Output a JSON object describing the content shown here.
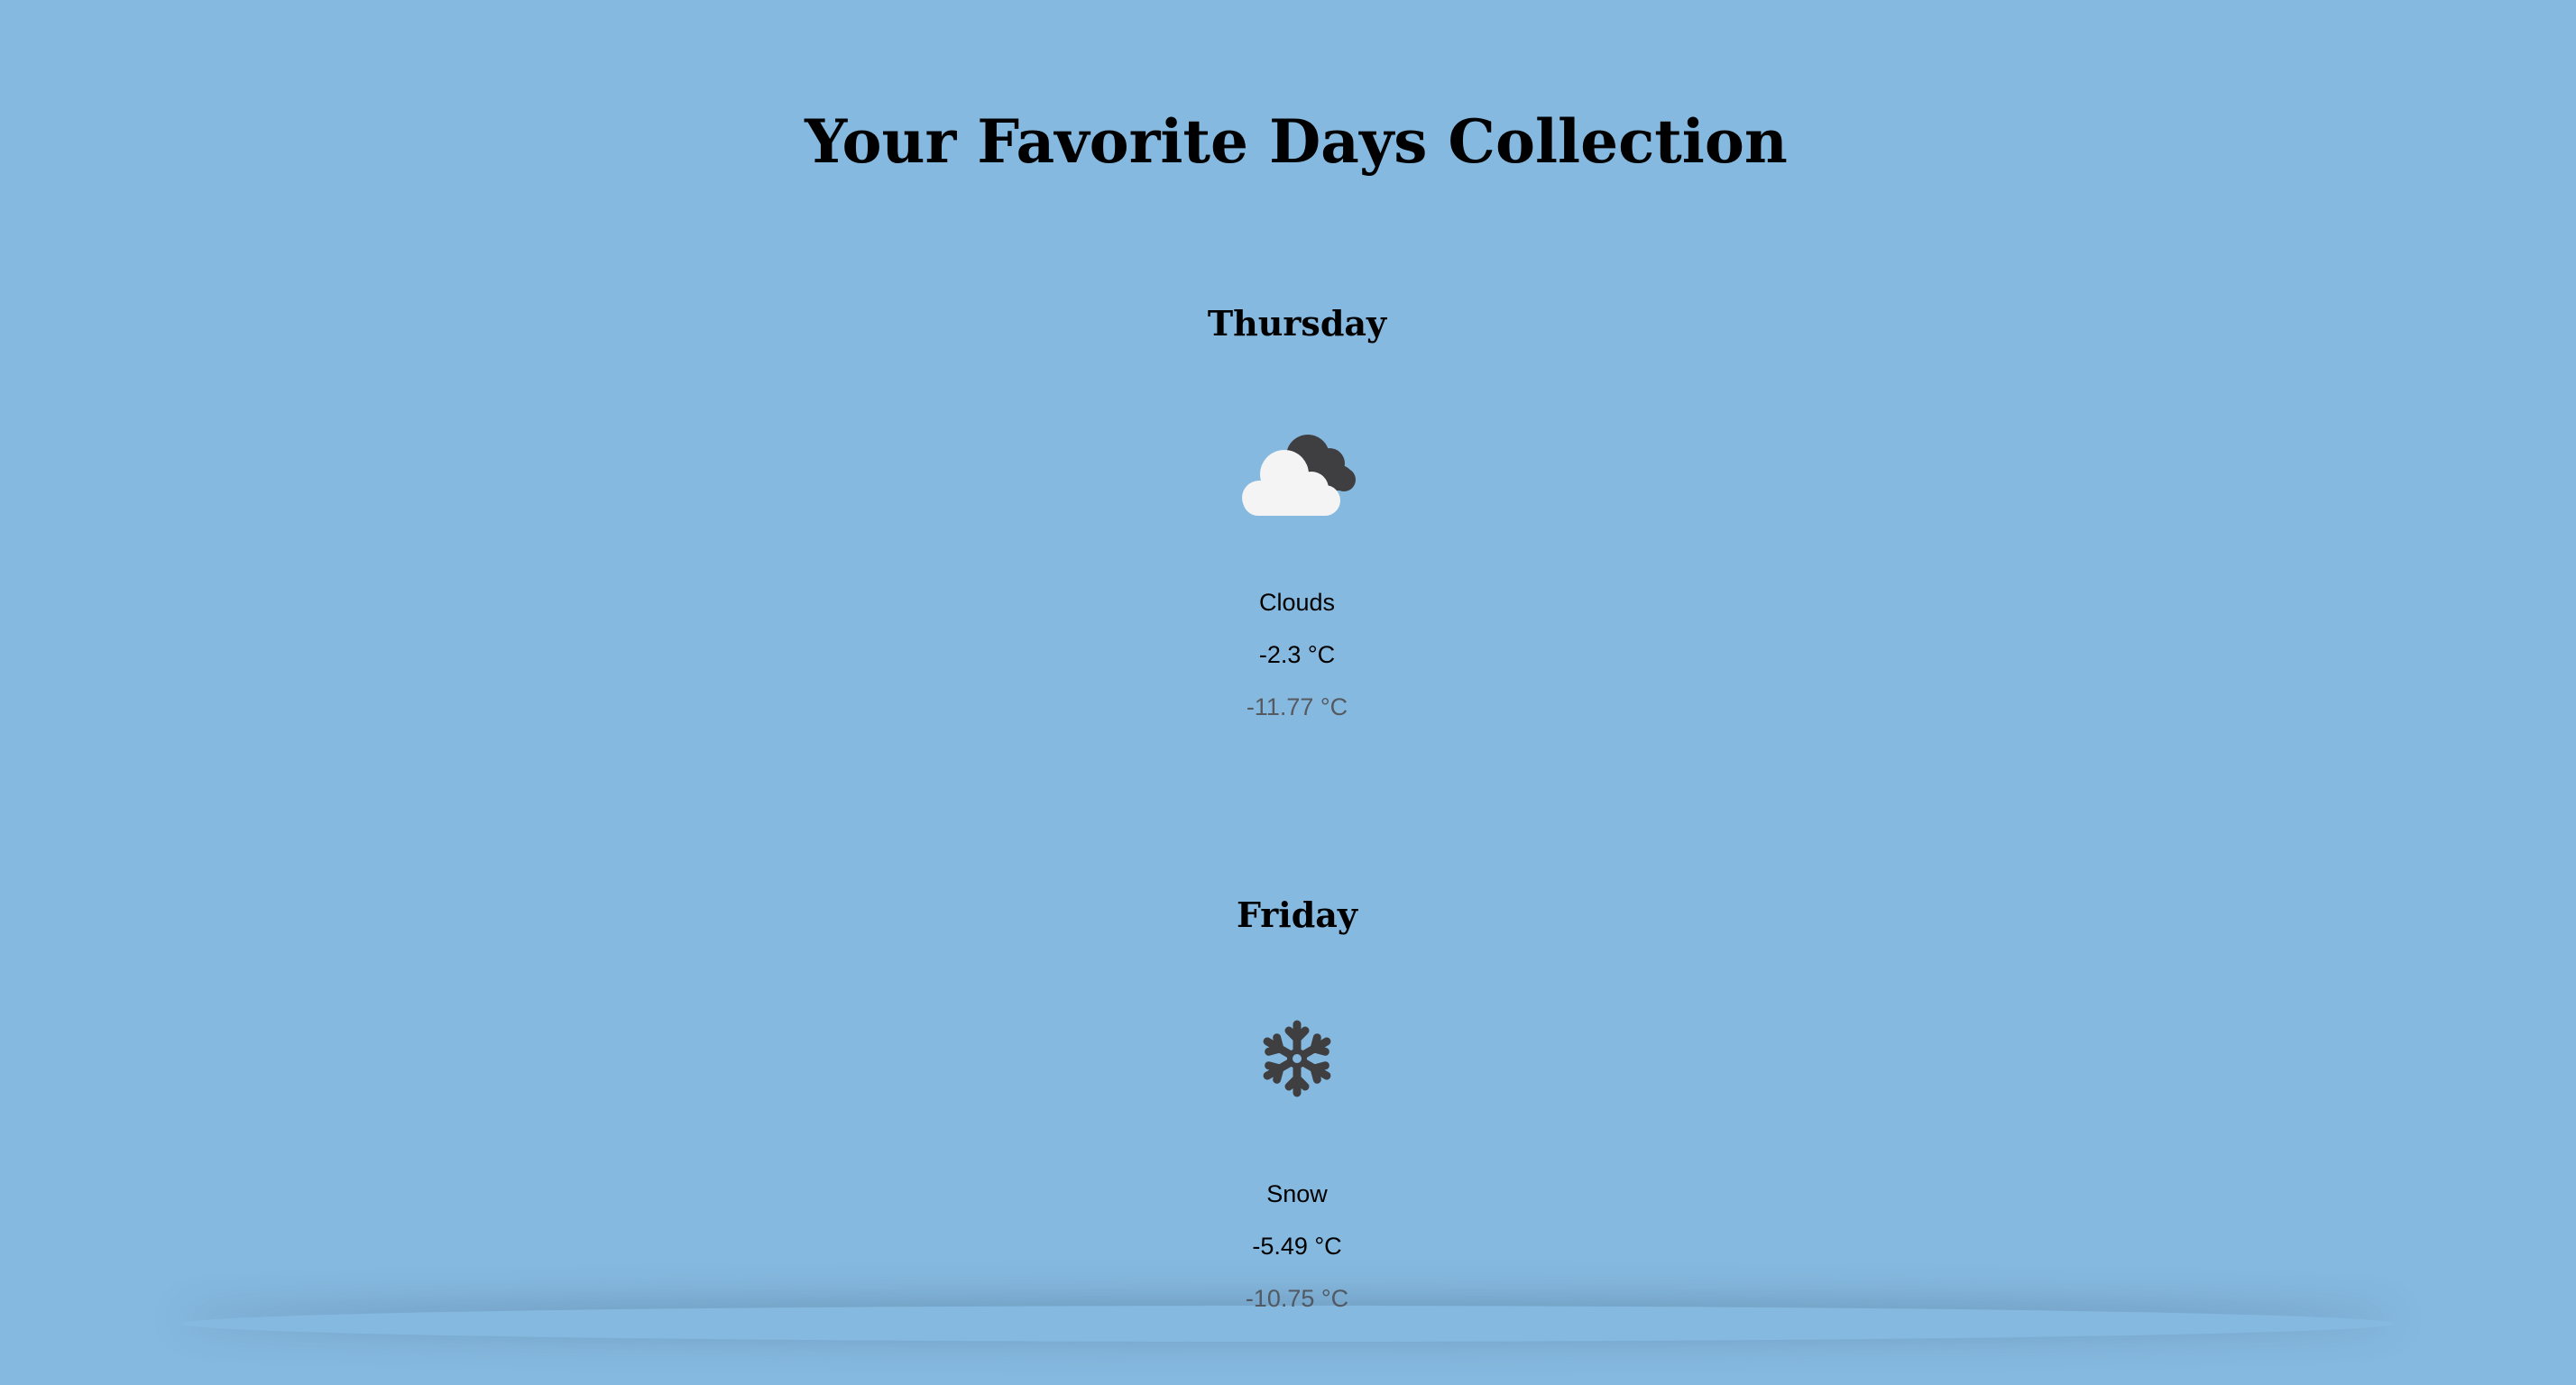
{
  "page": {
    "title": "Your Favorite Days Collection",
    "background_color": "#86b9df"
  },
  "days": [
    {
      "day": "Thursday",
      "icon": "clouds-icon",
      "condition": "Clouds",
      "temp_max": "-2.3 °C",
      "temp_min": "-11.77 °C"
    },
    {
      "day": "Friday",
      "icon": "snowflake-icon",
      "condition": "Snow",
      "temp_max": "-5.49 °C",
      "temp_min": "-10.75 °C"
    }
  ]
}
